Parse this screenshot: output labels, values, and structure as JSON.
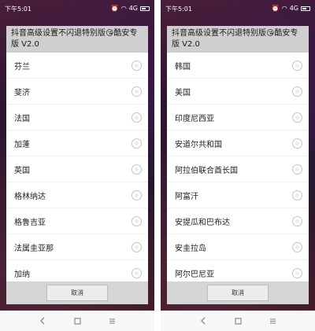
{
  "status": {
    "time": "下午5:01",
    "signal": "4G"
  },
  "dialog": {
    "title": "抖音高级设置不闪退特别版😘酷安专版 V2.0",
    "cancel_label": "取消"
  },
  "left_list": [
    {
      "label": "芬兰"
    },
    {
      "label": "斐济"
    },
    {
      "label": "法国"
    },
    {
      "label": "加蓬"
    },
    {
      "label": "英国"
    },
    {
      "label": "格林纳达"
    },
    {
      "label": "格鲁吉亚"
    },
    {
      "label": "法属圭亚那"
    },
    {
      "label": "加纳"
    }
  ],
  "right_list": [
    {
      "label": "韩国"
    },
    {
      "label": "美国"
    },
    {
      "label": "印度尼西亚"
    },
    {
      "label": "安道尔共和国"
    },
    {
      "label": "阿拉伯联合酋长国"
    },
    {
      "label": "阿富汗"
    },
    {
      "label": "安提瓜和巴布达"
    },
    {
      "label": "安圭拉岛"
    },
    {
      "label": "阿尔巴尼亚"
    }
  ],
  "icons": {
    "back": "back-icon",
    "home": "home-icon",
    "menu": "menu-icon"
  }
}
